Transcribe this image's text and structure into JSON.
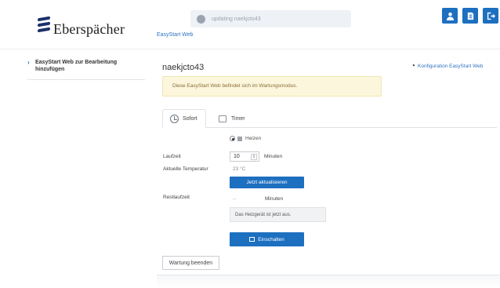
{
  "header": {
    "brand": "Eberspächer",
    "app_link": "EasyStart Web",
    "status_text": "updating naekjcto43",
    "status_right": "",
    "buttons": [
      {
        "icon": "user-icon"
      },
      {
        "icon": "document-icon"
      },
      {
        "icon": "logout-icon"
      }
    ]
  },
  "sidebar": {
    "items": [
      {
        "label": "EasyStart Web zur Bearbeitung hinzufügen",
        "icon": "chevron-right-icon"
      }
    ]
  },
  "main": {
    "device_name": "naekjcto43",
    "config_link": "Konfiguration EasyStart Web",
    "alert": "Diese EasyStart Web befindet sich im Wartungsmodus.",
    "tabs": [
      {
        "label": "Sofort",
        "icon": "clock-icon",
        "active": true
      },
      {
        "label": "Timer",
        "icon": "calendar-icon",
        "active": false
      }
    ],
    "mode_option": "Heizen",
    "fields": {
      "laufzeit_label": "Laufzeit",
      "laufzeit_value": "10",
      "laufzeit_unit": "Minuten",
      "temp_label": "Aktuelle Temperatur",
      "temp_value": "23 °C",
      "refresh_button": "Jetzt aktualisieren",
      "rest_label": "Restlaufzeit",
      "rest_value": "--",
      "rest_unit": "Minuten",
      "status_message": "Das Heizgerät ist jetzt aus.",
      "on_button": "Einschalten"
    },
    "end_maintenance_button": "Wartung beenden"
  },
  "colors": {
    "accent": "#1d6fc0",
    "link": "#2f74c0",
    "alert_bg": "#fcf6dc",
    "alert_text": "#8a6d3b"
  }
}
